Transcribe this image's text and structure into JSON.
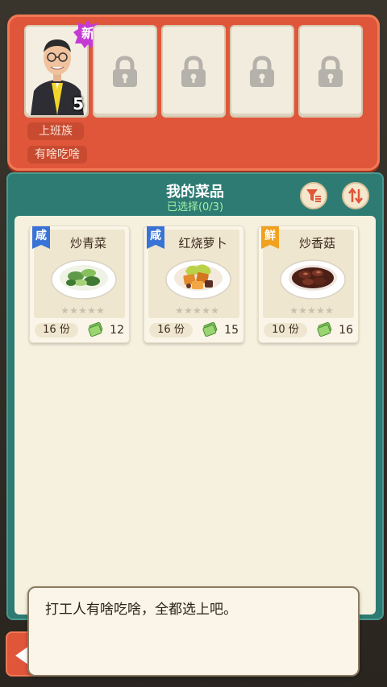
{
  "customer": {
    "slots_locked": 4,
    "new_badge": "新",
    "count": "5",
    "name": "上班族",
    "wish": "有啥吃啥"
  },
  "menu": {
    "title": "我的菜品",
    "selected": "已选择(0/3)",
    "filter_icon": "filter-icon",
    "sort_icon": "sort-icon"
  },
  "dishes": [
    {
      "tag": "咸",
      "tag_color": "#3a73d6",
      "name": "炒青菜",
      "portions": "16 份",
      "price": "12"
    },
    {
      "tag": "咸",
      "tag_color": "#3a73d6",
      "name": "红烧萝卜",
      "portions": "16 份",
      "price": "15"
    },
    {
      "tag": "鲜",
      "tag_color": "#f0a21f",
      "name": "炒香菇",
      "portions": "10 份",
      "price": "16"
    }
  ],
  "dialog": {
    "text": "打工人有啥吃啥，全都选上吧。"
  }
}
